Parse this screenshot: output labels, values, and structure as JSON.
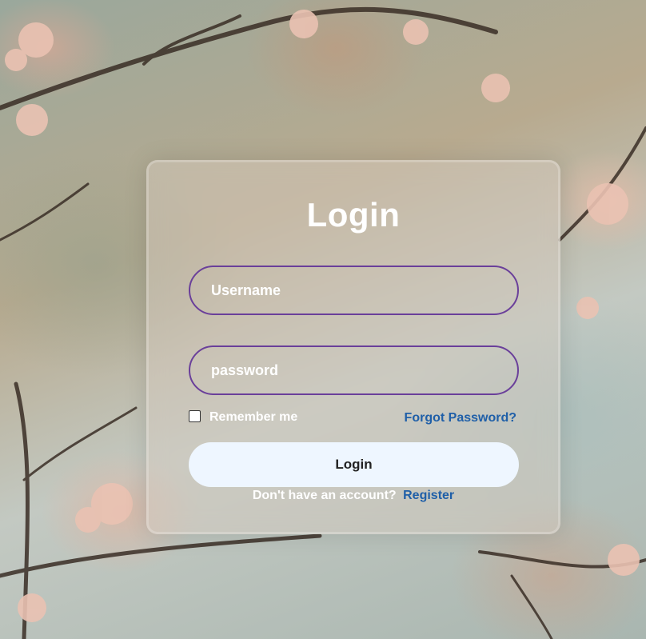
{
  "form": {
    "title": "Login",
    "username_placeholder": "Username",
    "password_placeholder": "password",
    "remember_label": "Remember me",
    "forgot_label": "Forgot Password?",
    "login_label": "Login",
    "register_prompt": "Don't have an account?",
    "register_label": "Register"
  },
  "colors": {
    "field_border": "#6a3f9a",
    "link": "#1f5fa8",
    "button_bg": "#eef6ff"
  }
}
